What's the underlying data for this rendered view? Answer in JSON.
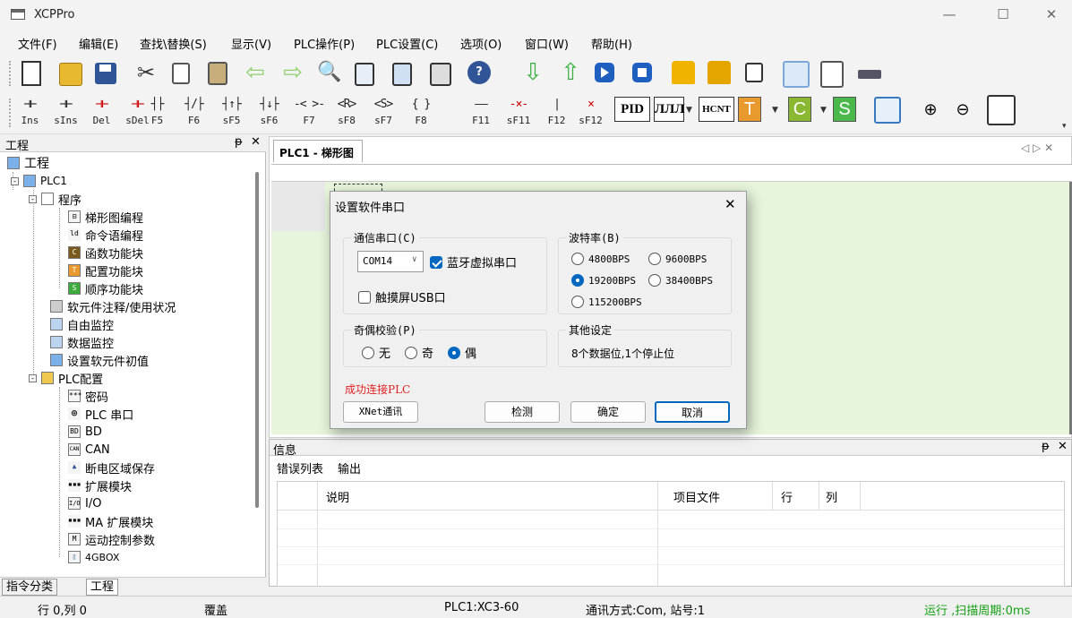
{
  "window": {
    "title": "XCPPro",
    "minimize": "—",
    "maximize": "☐",
    "close": "✕"
  },
  "menu": [
    "文件(F)",
    "编辑(E)",
    "查找\\替换(S)",
    "显示(V)",
    "PLC操作(P)",
    "PLC设置(C)",
    "选项(O)",
    "窗口(W)",
    "帮助(H)"
  ],
  "toolbar1": {
    "icons": [
      "new-file",
      "open-folder",
      "save",
      "cut",
      "copy",
      "paste",
      "back-arrow",
      "forward-arrow",
      "find-binoculars",
      "document",
      "list",
      "print",
      "help",
      "download",
      "upload",
      "run",
      "stop",
      "lock",
      "unlock",
      "monitor",
      "zoom-page",
      "zoom-doc",
      "serial-port"
    ]
  },
  "toolbar2": {
    "buttons": [
      {
        "sym": "⊣⊢",
        "key": "Ins"
      },
      {
        "sym": "⊣⊢",
        "key": "sIns"
      },
      {
        "sym": "⊣⊢",
        "key": "Del"
      },
      {
        "sym": "⊣⊢",
        "key": "sDel"
      },
      {
        "sym": "┤├",
        "key": "F5"
      },
      {
        "sym": "┤/├",
        "key": "F6"
      },
      {
        "sym": "┤↑├",
        "key": "sF5"
      },
      {
        "sym": "┤↓├",
        "key": "sF6"
      },
      {
        "sym": "-< >-",
        "key": "F7"
      },
      {
        "sym": "<R>",
        "key": "sF8"
      },
      {
        "sym": "<S>",
        "key": "sF7"
      },
      {
        "sym": "{ }",
        "key": "F8"
      },
      {
        "sym": "——",
        "key": "F11"
      },
      {
        "sym": "-×-",
        "key": "sF11"
      },
      {
        "sym": "|",
        "key": "F12"
      },
      {
        "sym": "×",
        "key": "sF12"
      }
    ],
    "pid": "PID",
    "pulse": "ЛЛЛ",
    "hcnt": "HCNT",
    "t": "T",
    "c": "C",
    "s": "S"
  },
  "left_pane": {
    "header": "工程",
    "pin": "ᵽ",
    "close": "✕",
    "items": [
      {
        "label": "工程",
        "icon": "",
        "level": 0
      },
      {
        "label": "PLC1",
        "icon": "",
        "level": 1
      },
      {
        "label": "程序",
        "icon": "",
        "level": 2
      },
      {
        "label": "梯形图编程",
        "icon": "",
        "level": 3
      },
      {
        "label": "命令语编程",
        "icon": "ld",
        "level": 3
      },
      {
        "label": "函数功能块",
        "icon": "C",
        "level": 3
      },
      {
        "label": "配置功能块",
        "icon": "T",
        "level": 3
      },
      {
        "label": "顺序功能块",
        "icon": "S",
        "level": 3
      },
      {
        "label": "软元件注释/使用状况",
        "icon": "",
        "level": 2
      },
      {
        "label": "自由监控",
        "icon": "",
        "level": 2
      },
      {
        "label": "数据监控",
        "icon": "",
        "level": 2
      },
      {
        "label": "设置软元件初值",
        "icon": "",
        "level": 2
      },
      {
        "label": "PLC配置",
        "icon": "",
        "level": 2
      },
      {
        "label": "密码",
        "icon": "",
        "level": 3
      },
      {
        "label": "PLC 串口",
        "icon": "",
        "level": 3
      },
      {
        "label": "BD",
        "icon": "BD",
        "level": 3
      },
      {
        "label": "CAN",
        "icon": "CAN",
        "level": 3
      },
      {
        "label": "断电区域保存",
        "icon": "",
        "level": 3
      },
      {
        "label": "扩展模块",
        "icon": "",
        "level": 3
      },
      {
        "label": "I/O",
        "icon": "I/O",
        "level": 3
      },
      {
        "label": "MA 扩展模块",
        "icon": "",
        "level": 3
      },
      {
        "label": "运动控制参数",
        "icon": "M",
        "level": 3
      },
      {
        "label": "4GBOX",
        "icon": "",
        "level": 3
      }
    ],
    "bottom_tabs": [
      "指令分类",
      "工程"
    ]
  },
  "doc": {
    "tab": "PLC1 - 梯形图",
    "nav": "◁ ▷ ✕"
  },
  "info": {
    "title": "信息",
    "pin": "ᵽ",
    "close": "✕",
    "tabs": [
      "错误列表",
      "输出"
    ],
    "columns": [
      "说明",
      "项目文件",
      "行",
      "列"
    ]
  },
  "dialog": {
    "title": "设置软件串口",
    "close": "✕",
    "comm_group": "通信串口(C)",
    "port_value": "COM14",
    "bluetooth": "蓝牙虚拟串口",
    "touch_usb": "触摸屏USB口",
    "baud_group": "波特率(B)",
    "baud": [
      "4800BPS",
      "9600BPS",
      "19200BPS",
      "38400BPS",
      "115200BPS"
    ],
    "baud_selected": "19200BPS",
    "parity_group": "奇偶校验(P)",
    "parity": [
      "无",
      "奇",
      "偶"
    ],
    "parity_selected": "偶",
    "other_group": "其他设定",
    "other_text": "8个数据位,1个停止位",
    "status": "成功连接PLC",
    "status_color": "#e02020",
    "btn_xnet": "XNet通讯",
    "btn_detect": "检测",
    "btn_ok": "确定",
    "btn_cancel": "取消"
  },
  "status": {
    "pos": "行 0,列 0",
    "mode": "覆盖",
    "plc": "PLC1:XC3-60",
    "comm": "通讯方式:Com, 站号:1",
    "run": "运行 ,扫描周期:0ms",
    "run_color": "#14a014"
  }
}
